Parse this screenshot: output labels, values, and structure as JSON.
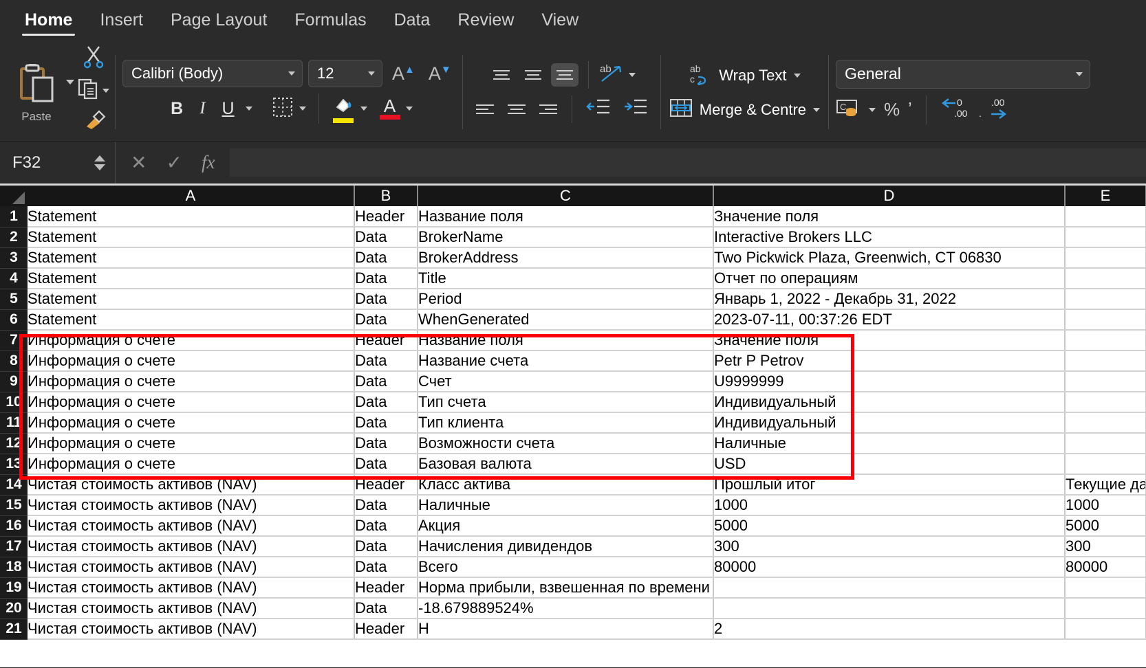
{
  "ribbon": {
    "tabs": [
      {
        "label": "Home",
        "active": true
      },
      {
        "label": "Insert",
        "active": false
      },
      {
        "label": "Page Layout",
        "active": false
      },
      {
        "label": "Formulas",
        "active": false
      },
      {
        "label": "Data",
        "active": false
      },
      {
        "label": "Review",
        "active": false
      },
      {
        "label": "View",
        "active": false
      }
    ],
    "clipboard": {
      "paste_label": "Paste",
      "paste_icon": "clipboard-icon",
      "cut_icon": "scissors-icon",
      "copy_icon": "copy-icon",
      "format_painter_icon": "format-painter-icon"
    },
    "font": {
      "name_value": "Calibri (Body)",
      "size_value": "12",
      "grow_font_label": "A",
      "shrink_font_label": "A",
      "bold_label": "B",
      "italic_label": "I",
      "underline_label": "U",
      "borders_icon": "borders-icon",
      "fill_color_icon": "fill-color-icon",
      "fill_color": "#f5e400",
      "font_color_icon": "font-color-icon",
      "font_color": "#e81123",
      "font_color_label": "A"
    },
    "alignment": {
      "top_align_icon": "align-top-icon",
      "middle_align_icon": "align-middle-icon",
      "bottom_align_icon": "align-bottom-icon",
      "orientation_icon": "text-orientation-icon",
      "left_align_icon": "align-left-icon",
      "center_align_icon": "align-center-icon",
      "right_align_icon": "align-right-icon",
      "decrease_indent_icon": "decrease-indent-icon",
      "increase_indent_icon": "increase-indent-icon"
    },
    "wrap": {
      "wrap_text_label": "Wrap Text",
      "wrap_text_icon": "wrap-text-icon",
      "merge_label": "Merge & Centre",
      "merge_icon": "merge-cells-icon"
    },
    "number": {
      "format_value": "General",
      "accounting_icon": "accounting-format-icon",
      "percent_label": "%",
      "comma_label": "ʼ",
      "increase_decimal_icon": "increase-decimal-icon",
      "decrease_decimal_icon": "decrease-decimal-icon",
      "increase_decimal_label": ".00",
      "decrease_decimal_label": ".00"
    }
  },
  "formula_bar": {
    "name_box_value": "F32",
    "cancel_icon": "cancel-icon",
    "enter_icon": "confirm-check-icon",
    "function_icon": "insert-function-icon",
    "formula_value": "",
    "formula_placeholder": ""
  },
  "grid": {
    "columns": [
      "A",
      "B",
      "C",
      "D",
      "E"
    ],
    "row_numbers": [
      "1",
      "2",
      "3",
      "4",
      "5",
      "6",
      "7",
      "8",
      "9",
      "10",
      "11",
      "12",
      "13",
      "14",
      "15",
      "16",
      "17",
      "18",
      "19",
      "20",
      "21"
    ],
    "rows": [
      [
        "Statement",
        "Header",
        "Название поля",
        "Значение поля",
        ""
      ],
      [
        "Statement",
        "Data",
        "BrokerName",
        "Interactive Brokers LLC",
        ""
      ],
      [
        "Statement",
        "Data",
        "BrokerAddress",
        "Two Pickwick Plaza, Greenwich, CT 06830",
        ""
      ],
      [
        "Statement",
        "Data",
        "Title",
        "Отчет по операциям",
        ""
      ],
      [
        "Statement",
        "Data",
        "Period",
        "Январь 1, 2022 - Декабрь 31, 2022",
        ""
      ],
      [
        "Statement",
        "Data",
        "WhenGenerated",
        "2023-07-11, 00:37:26 EDT",
        ""
      ],
      [
        "Информация о счете",
        "Header",
        "Название поля",
        "Значение поля",
        ""
      ],
      [
        "Информация о счете",
        "Data",
        "Название счета",
        "Petr P Petrov",
        ""
      ],
      [
        "Информация о счете",
        "Data",
        "Счет",
        "U9999999",
        ""
      ],
      [
        "Информация о счете",
        "Data",
        "Тип счета",
        "Индивидуальный",
        ""
      ],
      [
        "Информация о счете",
        "Data",
        "Тип клиента",
        "Индивидуальный",
        ""
      ],
      [
        "Информация о счете",
        "Data",
        "Возможности счета",
        "Наличные",
        ""
      ],
      [
        "Информация о счете",
        "Data",
        "Базовая валюта",
        "USD",
        ""
      ],
      [
        "Чистая стоимость активов (NAV)",
        "Header",
        "Класс актива",
        "Прошлый итог",
        "Текущие да"
      ],
      [
        "Чистая стоимость активов (NAV)",
        "Data",
        "Наличные",
        "1000",
        "1000"
      ],
      [
        "Чистая стоимость активов (NAV)",
        "Data",
        "Акция",
        "5000",
        "5000"
      ],
      [
        "Чистая стоимость активов (NAV)",
        "Data",
        "Начисления дивидендов",
        "300",
        "300"
      ],
      [
        "Чистая стоимость активов (NAV)",
        "Data",
        "Всего",
        "80000",
        "80000"
      ],
      [
        "Чистая стоимость активов (NAV)",
        "Header",
        "Норма прибыли, взвешенная по времени",
        "",
        ""
      ],
      [
        "Чистая стоимость активов (NAV)",
        "Data",
        "-18.679889524%",
        "",
        ""
      ],
      [
        "Чистая стоимость активов (NAV)",
        "Header",
        "Н",
        "2",
        ""
      ]
    ]
  },
  "annotation": {
    "highlight_color": "#fb0007",
    "name": "red-highlight-rectangle",
    "covers_rows": "7-13"
  }
}
